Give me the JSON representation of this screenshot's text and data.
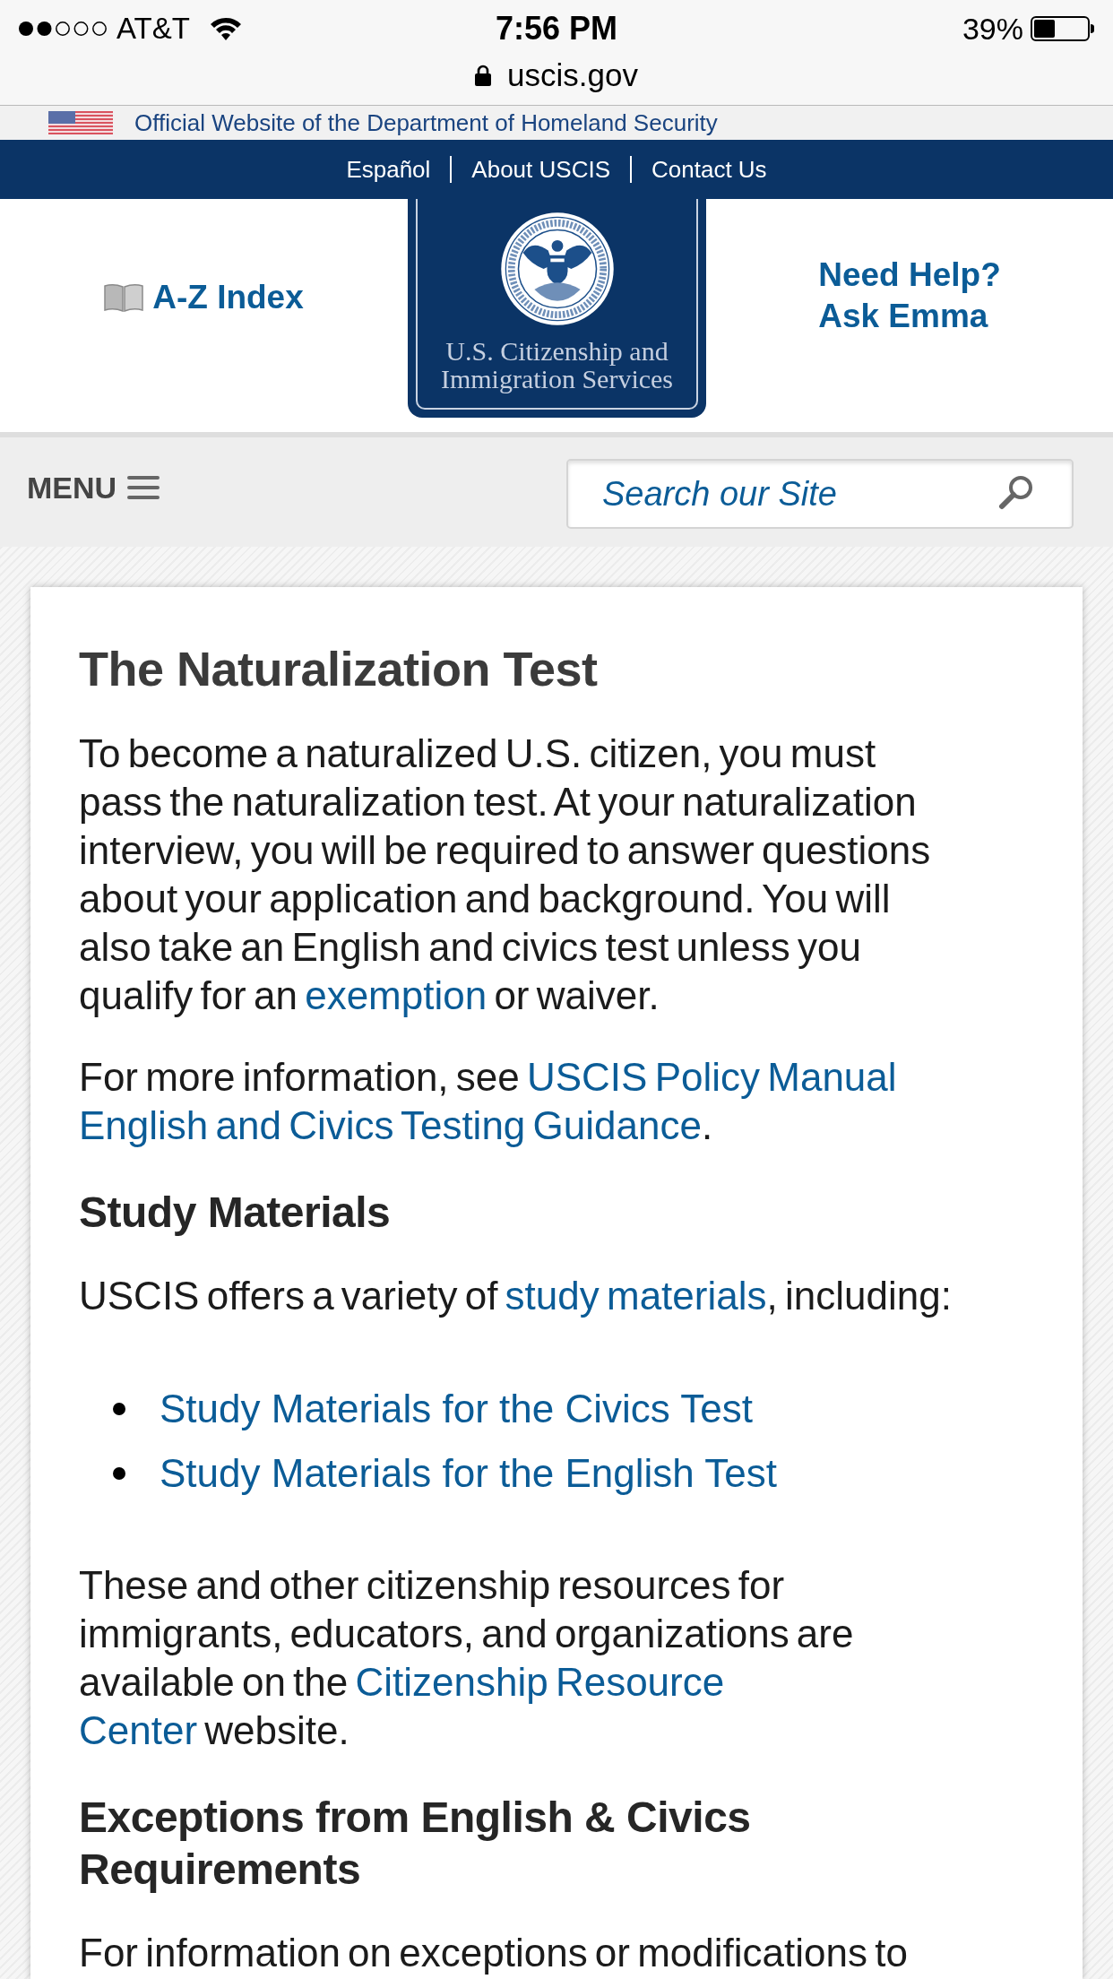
{
  "status_bar": {
    "carrier": "AT&T",
    "time": "7:56 PM",
    "battery": "39%"
  },
  "address_bar": {
    "url": "uscis.gov"
  },
  "official_banner": {
    "text": "Official Website of the Department of Homeland Security"
  },
  "top_links": [
    {
      "label": "Español"
    },
    {
      "label": "About USCIS"
    },
    {
      "label": "Contact Us"
    }
  ],
  "header": {
    "index_link": "A-Z Index",
    "logo": {
      "lines": [
        "U.S. Citizenship and",
        "Immigration Services"
      ]
    },
    "help_link": {
      "lines": [
        "Need Help?",
        "Ask Emma"
      ]
    }
  },
  "nav_bar": {
    "menu": "MENU",
    "search": {
      "placeholder": "Search our Site"
    }
  },
  "article": [
    {
      "kind": "title",
      "text": "The Naturalization Test"
    },
    {
      "kind": "paragraph",
      "segments": [
        {
          "kind": "text",
          "text": "To become a naturalized U.S. citizen, you must pass the naturalization test. At your naturalization interview, you will be required to answer questions about your application and background. You will also take an English and civics test unless you qualify for an "
        },
        {
          "kind": "link",
          "text": "exemption"
        },
        {
          "kind": "text",
          "text": " or waiver."
        }
      ]
    },
    {
      "kind": "paragraph",
      "segments": [
        {
          "kind": "text",
          "text": "For more information, see "
        },
        {
          "kind": "link",
          "text": "USCIS Policy Manual"
        },
        {
          "kind": "link",
          "text": "English and Civics Testing Guidance"
        },
        {
          "kind": "text",
          "text": "."
        }
      ]
    },
    {
      "kind": "heading",
      "text": "Study Materials"
    },
    {
      "kind": "paragraph",
      "segments": [
        {
          "kind": "text",
          "text": "USCIS offers a variety of "
        },
        {
          "kind": "link",
          "text": "study materials"
        },
        {
          "kind": "text",
          "text": ", including:"
        }
      ]
    },
    {
      "kind": "list",
      "items": [
        {
          "text": "Study Materials for the Civics Test"
        },
        {
          "text": "Study Materials for the English Test"
        }
      ]
    },
    {
      "kind": "paragraph",
      "segments": [
        {
          "kind": "text",
          "text": "These and other citizenship resources for immigrants, educators, and organizations are available on the "
        },
        {
          "kind": "link",
          "text": "Citizenship Resource"
        },
        {
          "kind": "link",
          "text": "Center",
          "line_break_before": true
        },
        {
          "kind": "text",
          "text": " website."
        }
      ]
    },
    {
      "kind": "heading",
      "text": "Exceptions from English & Civics Requirements"
    },
    {
      "kind": "paragraph",
      "segments": [
        {
          "kind": "text",
          "text": "For information on exceptions or modifications to"
        }
      ]
    }
  ]
}
